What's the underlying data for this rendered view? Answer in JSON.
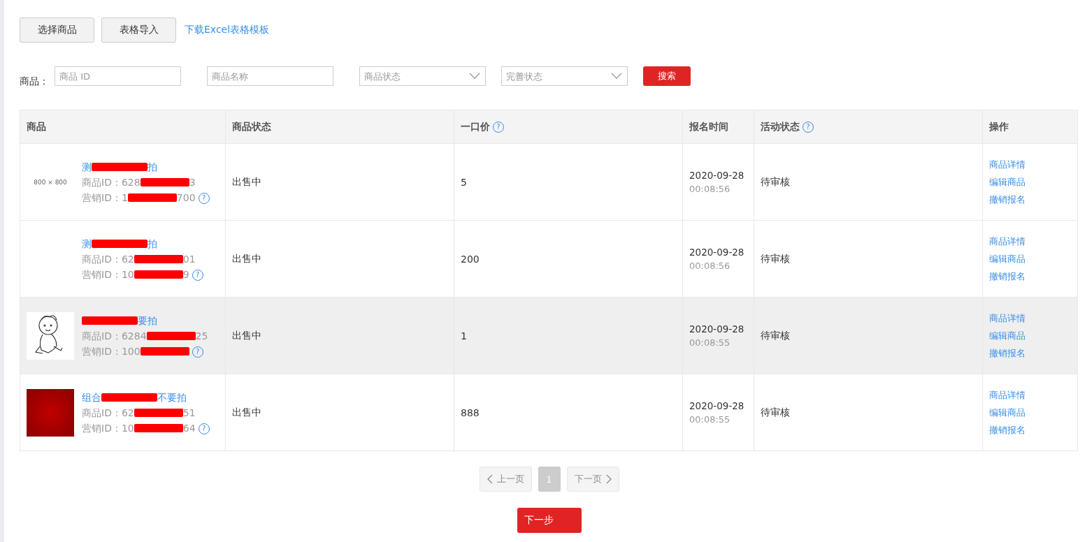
{
  "toolbar": {
    "buttons": [
      "选择商品",
      "表格导入"
    ],
    "link": "下载Excel表格模板"
  },
  "filters": {
    "label": "商品：",
    "fields": [
      {
        "kind": "input",
        "placeholder": "商品 ID"
      },
      {
        "kind": "input",
        "placeholder": "商品名称"
      },
      {
        "kind": "select",
        "placeholder": "商品状态"
      },
      {
        "kind": "select",
        "placeholder": "完善状态"
      }
    ],
    "search_button": "搜索"
  },
  "table": {
    "columns": [
      {
        "label": "商品"
      },
      {
        "label": "商品状态"
      },
      {
        "label": "一口价",
        "help": "?"
      },
      {
        "label": "报名时间"
      },
      {
        "label": "活动状态",
        "help": "?"
      },
      {
        "label": "操作"
      }
    ],
    "rows": [
      {
        "highlighted": false,
        "image": {
          "kind": "placeholder",
          "text": "800 × 800"
        },
        "name": [
          {
            "kind": "text",
            "text": "测"
          },
          {
            "kind": "redaction"
          },
          {
            "kind": "text",
            "text": "拍"
          }
        ],
        "product_id": [
          {
            "kind": "text",
            "text": "商品ID：628"
          },
          {
            "kind": "redaction"
          },
          {
            "kind": "text",
            "text": "3"
          }
        ],
        "marketing_id": [
          {
            "kind": "text",
            "text": "营销ID：1"
          },
          {
            "kind": "redaction"
          },
          {
            "kind": "text",
            "text": "700"
          }
        ],
        "help": "?",
        "status": "出售中",
        "price": "5",
        "date": "2020-09-28",
        "time": "00:08:56",
        "activity": "待审核",
        "actions": [
          "商品详情",
          "编辑商品",
          "撤销报名"
        ]
      },
      {
        "highlighted": false,
        "image": {
          "kind": "none"
        },
        "name": [
          {
            "kind": "text",
            "text": "测"
          },
          {
            "kind": "redaction"
          },
          {
            "kind": "text",
            "text": "拍"
          }
        ],
        "product_id": [
          {
            "kind": "text",
            "text": "商品ID：62"
          },
          {
            "kind": "redaction"
          },
          {
            "kind": "text",
            "text": "01"
          }
        ],
        "marketing_id": [
          {
            "kind": "text",
            "text": "营销ID：10"
          },
          {
            "kind": "redaction"
          },
          {
            "kind": "text",
            "text": "9"
          }
        ],
        "help": "?",
        "status": "出售中",
        "price": "200",
        "date": "2020-09-28",
        "time": "00:08:56",
        "activity": "待审核",
        "actions": [
          "商品详情",
          "编辑商品",
          "撤销报名"
        ]
      },
      {
        "highlighted": true,
        "image": {
          "kind": "sketch"
        },
        "name": [
          {
            "kind": "redaction"
          },
          {
            "kind": "text",
            "text": "要拍"
          }
        ],
        "product_id": [
          {
            "kind": "text",
            "text": "商品ID：6284"
          },
          {
            "kind": "redaction"
          },
          {
            "kind": "text",
            "text": "25"
          }
        ],
        "marketing_id": [
          {
            "kind": "text",
            "text": "营销ID：100"
          },
          {
            "kind": "redaction"
          }
        ],
        "help": "?",
        "status": "出售中",
        "price": "1",
        "date": "2020-09-28",
        "time": "00:08:55",
        "activity": "待审核",
        "actions": [
          "商品详情",
          "编辑商品",
          "撤销报名"
        ]
      },
      {
        "highlighted": false,
        "image": {
          "kind": "banner"
        },
        "name": [
          {
            "kind": "text",
            "text": "组合"
          },
          {
            "kind": "redaction"
          },
          {
            "kind": "text",
            "text": "不要拍"
          }
        ],
        "product_id": [
          {
            "kind": "text",
            "text": "商品ID：62"
          },
          {
            "kind": "redaction"
          },
          {
            "kind": "text",
            "text": "51"
          }
        ],
        "marketing_id": [
          {
            "kind": "text",
            "text": "营销ID：10"
          },
          {
            "kind": "redaction"
          },
          {
            "kind": "text",
            "text": "64"
          }
        ],
        "help": "?",
        "status": "出售中",
        "price": "888",
        "date": "2020-09-28",
        "time": "00:08:55",
        "activity": "待审核",
        "actions": [
          "商品详情",
          "编辑商品",
          "撤销报名"
        ]
      }
    ]
  },
  "pager": {
    "prev": {
      "label": "上一页",
      "disabled": true
    },
    "pages": [
      {
        "label": "1",
        "selected": true
      }
    ],
    "next": {
      "label": "下一页",
      "disabled": true
    }
  },
  "next_step": "下一步"
}
